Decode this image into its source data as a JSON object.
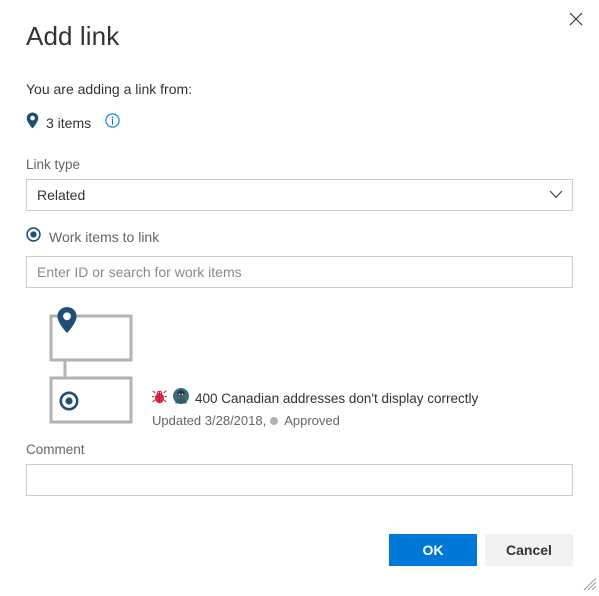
{
  "dialog": {
    "title": "Add link",
    "close_label": "Close"
  },
  "intro": {
    "text": "You are adding a link from:",
    "items_count": "3 items",
    "pin_icon": "location-pin-icon",
    "info_icon": "info-circle-icon"
  },
  "link_type": {
    "label": "Link type",
    "value": "Related",
    "options": [
      "Related"
    ],
    "chevron_icon": "chevron-down-icon"
  },
  "work_items": {
    "radio_label": "Work items to link",
    "radio_selected": true,
    "search_value": "",
    "search_placeholder": "Enter ID or search for work items"
  },
  "tree": {
    "parent_node_icon": "location-pin-icon",
    "child_node_icon": "target-radio-icon"
  },
  "result": {
    "type_icon": "bug-icon",
    "avatar_icon": "user-avatar-icon",
    "title": "400 Canadian addresses don't display correctly",
    "updated": "Updated 3/28/2018,",
    "state": "Approved",
    "state_color": "#b2b2b2"
  },
  "comment": {
    "label": "Comment",
    "value": "",
    "placeholder": ""
  },
  "footer": {
    "ok_label": "OK",
    "cancel_label": "Cancel"
  },
  "colors": {
    "accent": "#0078d7",
    "pin_navy": "#1f4e79",
    "border": "#cccccc",
    "bug_red": "#cc293d"
  }
}
